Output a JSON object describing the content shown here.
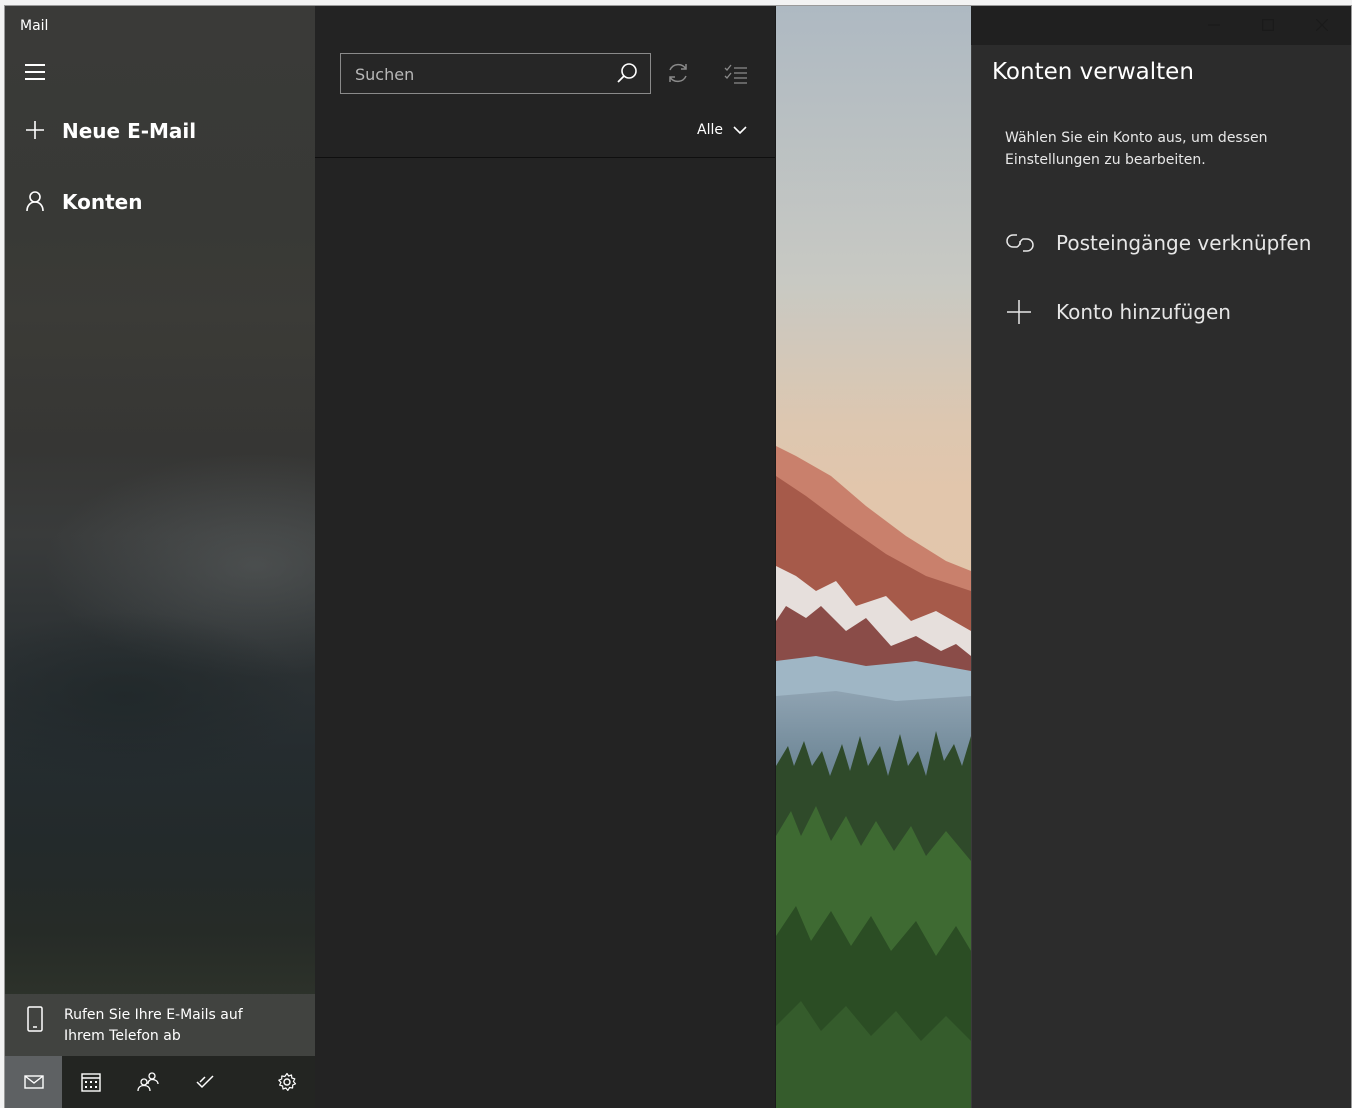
{
  "app": {
    "title": "Mail"
  },
  "nav": {
    "menu_icon": "hamburger-icon",
    "new_mail_label": "Neue E-Mail",
    "accounts_label": "Konten",
    "promo_text": "Rufen Sie Ihre E-Mails auf Ihrem Telefon ab",
    "bottom_icons": [
      "mail-icon",
      "calendar-icon",
      "people-icon",
      "todo-icon",
      "settings-icon"
    ]
  },
  "list": {
    "search_placeholder": "Suchen",
    "filter_label": "Alle"
  },
  "flyout": {
    "title": "Konten verwalten",
    "description": "Wählen Sie ein Konto aus, um dessen Einstellungen zu bearbeiten.",
    "link_inboxes_label": "Posteingänge verknüpfen",
    "add_account_label": "Konto hinzufügen"
  },
  "colors": {
    "accent_active": "#5e6163",
    "pane_bg": "#232323",
    "flyout_bg": "#2c2c2c"
  }
}
